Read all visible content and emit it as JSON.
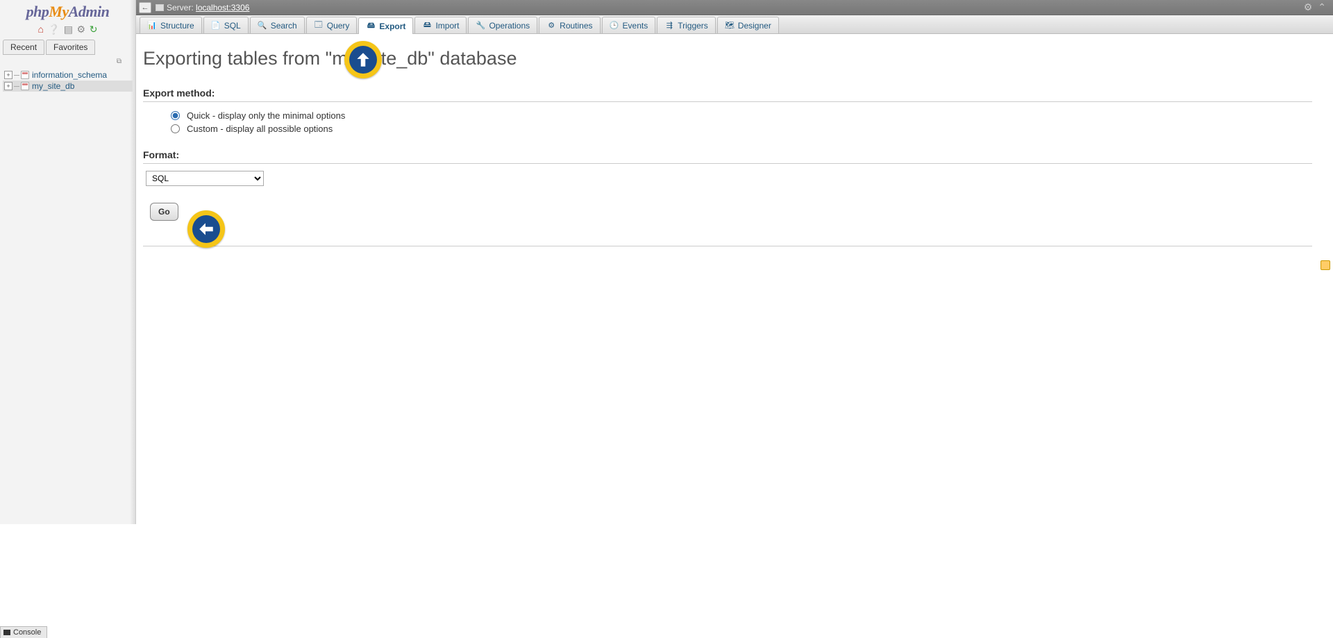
{
  "logo": {
    "php": "php",
    "my": "My",
    "admin": "Admin"
  },
  "sidebar_tabs": {
    "recent": "Recent",
    "favorites": "Favorites"
  },
  "tree": {
    "items": [
      {
        "label": "information_schema"
      },
      {
        "label": "my_site_db"
      }
    ]
  },
  "topbar": {
    "server_label": "Server:",
    "server_host": "localhost:3306"
  },
  "tabs": [
    {
      "label": "Structure"
    },
    {
      "label": "SQL"
    },
    {
      "label": "Search"
    },
    {
      "label": "Query"
    },
    {
      "label": "Export"
    },
    {
      "label": "Import"
    },
    {
      "label": "Operations"
    },
    {
      "label": "Routines"
    },
    {
      "label": "Events"
    },
    {
      "label": "Triggers"
    },
    {
      "label": "Designer"
    }
  ],
  "page": {
    "title": "Exporting tables from \"my_site_db\" database",
    "export_method_head": "Export method:",
    "quick_label": "Quick - display only the minimal options",
    "custom_label": "Custom - display all possible options",
    "format_head": "Format:",
    "format_selected": "SQL",
    "go_label": "Go"
  },
  "console": {
    "label": "Console"
  }
}
